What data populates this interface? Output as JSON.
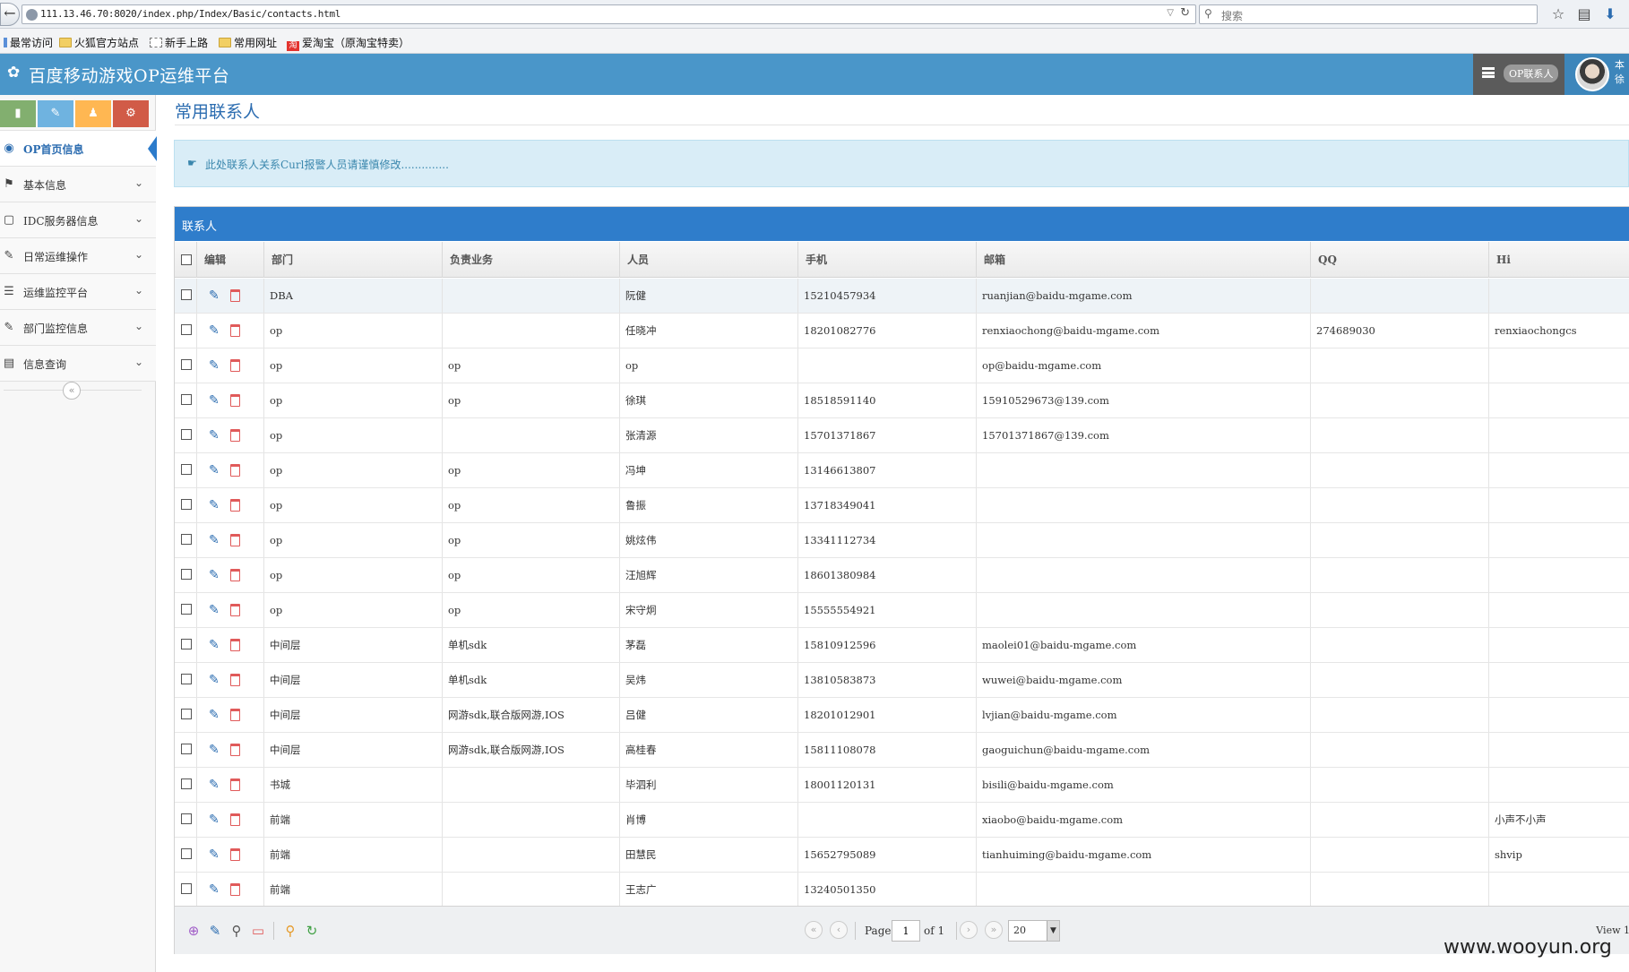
{
  "browser": {
    "url": "111.13.46.70:8020/index.php/Index/Basic/contacts.html",
    "search_placeholder": "搜索",
    "bookmarks": [
      "最常访问",
      "火狐官方站点",
      "新手上路",
      "常用网址",
      "爱淘宝（原淘宝特卖）"
    ]
  },
  "header": {
    "title": "百度移动游戏OP运维平台",
    "contacts_badge": "OP联系人",
    "user_name": "本 徐"
  },
  "sidebar": {
    "items": [
      {
        "label": "OP首页信息",
        "icon": "dashboard-icon"
      },
      {
        "label": "基本信息",
        "icon": "tag-icon"
      },
      {
        "label": "IDC服务器信息",
        "icon": "monitor-icon"
      },
      {
        "label": "日常运维操作",
        "icon": "edit-icon"
      },
      {
        "label": "运维监控平台",
        "icon": "list-icon"
      },
      {
        "label": "部门监控信息",
        "icon": "edit-icon"
      },
      {
        "label": "信息查询",
        "icon": "table-icon"
      }
    ]
  },
  "main": {
    "title": "常用联系人",
    "notice": "此处联系人关系Curl报警人员请谨慎修改..............",
    "grid_caption": "联系人",
    "columns": [
      "编辑",
      "部门",
      "负责业务",
      "人员",
      "手机",
      "邮箱",
      "QQ",
      "Hi"
    ],
    "rows": [
      {
        "dept": "DBA",
        "biz": "",
        "person": "阮健",
        "phone": "15210457934",
        "email": "ruanjian@baidu-mgame.com",
        "qq": "",
        "hi": ""
      },
      {
        "dept": "op",
        "biz": "",
        "person": "任晓冲",
        "phone": "18201082776",
        "email": "renxiaochong@baidu-mgame.com",
        "qq": "274689030",
        "hi": "renxiaochongcs"
      },
      {
        "dept": "op",
        "biz": "op",
        "person": "op",
        "phone": "",
        "email": "op@baidu-mgame.com",
        "qq": "",
        "hi": ""
      },
      {
        "dept": "op",
        "biz": "op",
        "person": "徐琪",
        "phone": "18518591140",
        "email": "15910529673@139.com",
        "qq": "",
        "hi": ""
      },
      {
        "dept": "op",
        "biz": "",
        "person": "张清源",
        "phone": "15701371867",
        "email": "15701371867@139.com",
        "qq": "",
        "hi": ""
      },
      {
        "dept": "op",
        "biz": "op",
        "person": "冯坤",
        "phone": "13146613807",
        "email": "",
        "qq": "",
        "hi": ""
      },
      {
        "dept": "op",
        "biz": "op",
        "person": "鲁振",
        "phone": "13718349041",
        "email": "",
        "qq": "",
        "hi": ""
      },
      {
        "dept": "op",
        "biz": "op",
        "person": "姚炫伟",
        "phone": "13341112734",
        "email": "",
        "qq": "",
        "hi": ""
      },
      {
        "dept": "op",
        "biz": "op",
        "person": "汪旭辉",
        "phone": "18601380984",
        "email": "",
        "qq": "",
        "hi": ""
      },
      {
        "dept": "op",
        "biz": "op",
        "person": "宋守炯",
        "phone": "15555554921",
        "email": "",
        "qq": "",
        "hi": ""
      },
      {
        "dept": "中间层",
        "biz": "单机sdk",
        "person": "茅磊",
        "phone": "15810912596",
        "email": "maolei01@baidu-mgame.com",
        "qq": "",
        "hi": ""
      },
      {
        "dept": "中间层",
        "biz": "单机sdk",
        "person": "吴炜",
        "phone": "13810583873",
        "email": "wuwei@baidu-mgame.com",
        "qq": "",
        "hi": ""
      },
      {
        "dept": "中间层",
        "biz": "网游sdk,联合版网游,IOS",
        "person": "吕健",
        "phone": "18201012901",
        "email": "lvjian@baidu-mgame.com",
        "qq": "",
        "hi": ""
      },
      {
        "dept": "中间层",
        "biz": "网游sdk,联合版网游,IOS",
        "person": "高桂春",
        "phone": "15811108078",
        "email": "gaoguichun@baidu-mgame.com",
        "qq": "",
        "hi": ""
      },
      {
        "dept": "书城",
        "biz": "",
        "person": "毕泗利",
        "phone": "18001120131",
        "email": "bisili@baidu-mgame.com",
        "qq": "",
        "hi": ""
      },
      {
        "dept": "前端",
        "biz": "",
        "person": "肖博",
        "phone": "",
        "email": "xiaobo@baidu-mgame.com",
        "qq": "",
        "hi": "小声不小声"
      },
      {
        "dept": "前端",
        "biz": "",
        "person": "田慧民",
        "phone": "15652795089",
        "email": "tianhuiming@baidu-mgame.com",
        "qq": "",
        "hi": "shvip"
      },
      {
        "dept": "前端",
        "biz": "",
        "person": "王志广",
        "phone": "13240501350",
        "email": "",
        "qq": "",
        "hi": ""
      }
    ]
  },
  "pager": {
    "page_label": "Page",
    "page_value": "1",
    "of_label": "of 1",
    "page_size": "20",
    "view_text": "View 1"
  },
  "watermark": "www.wooyun.org"
}
